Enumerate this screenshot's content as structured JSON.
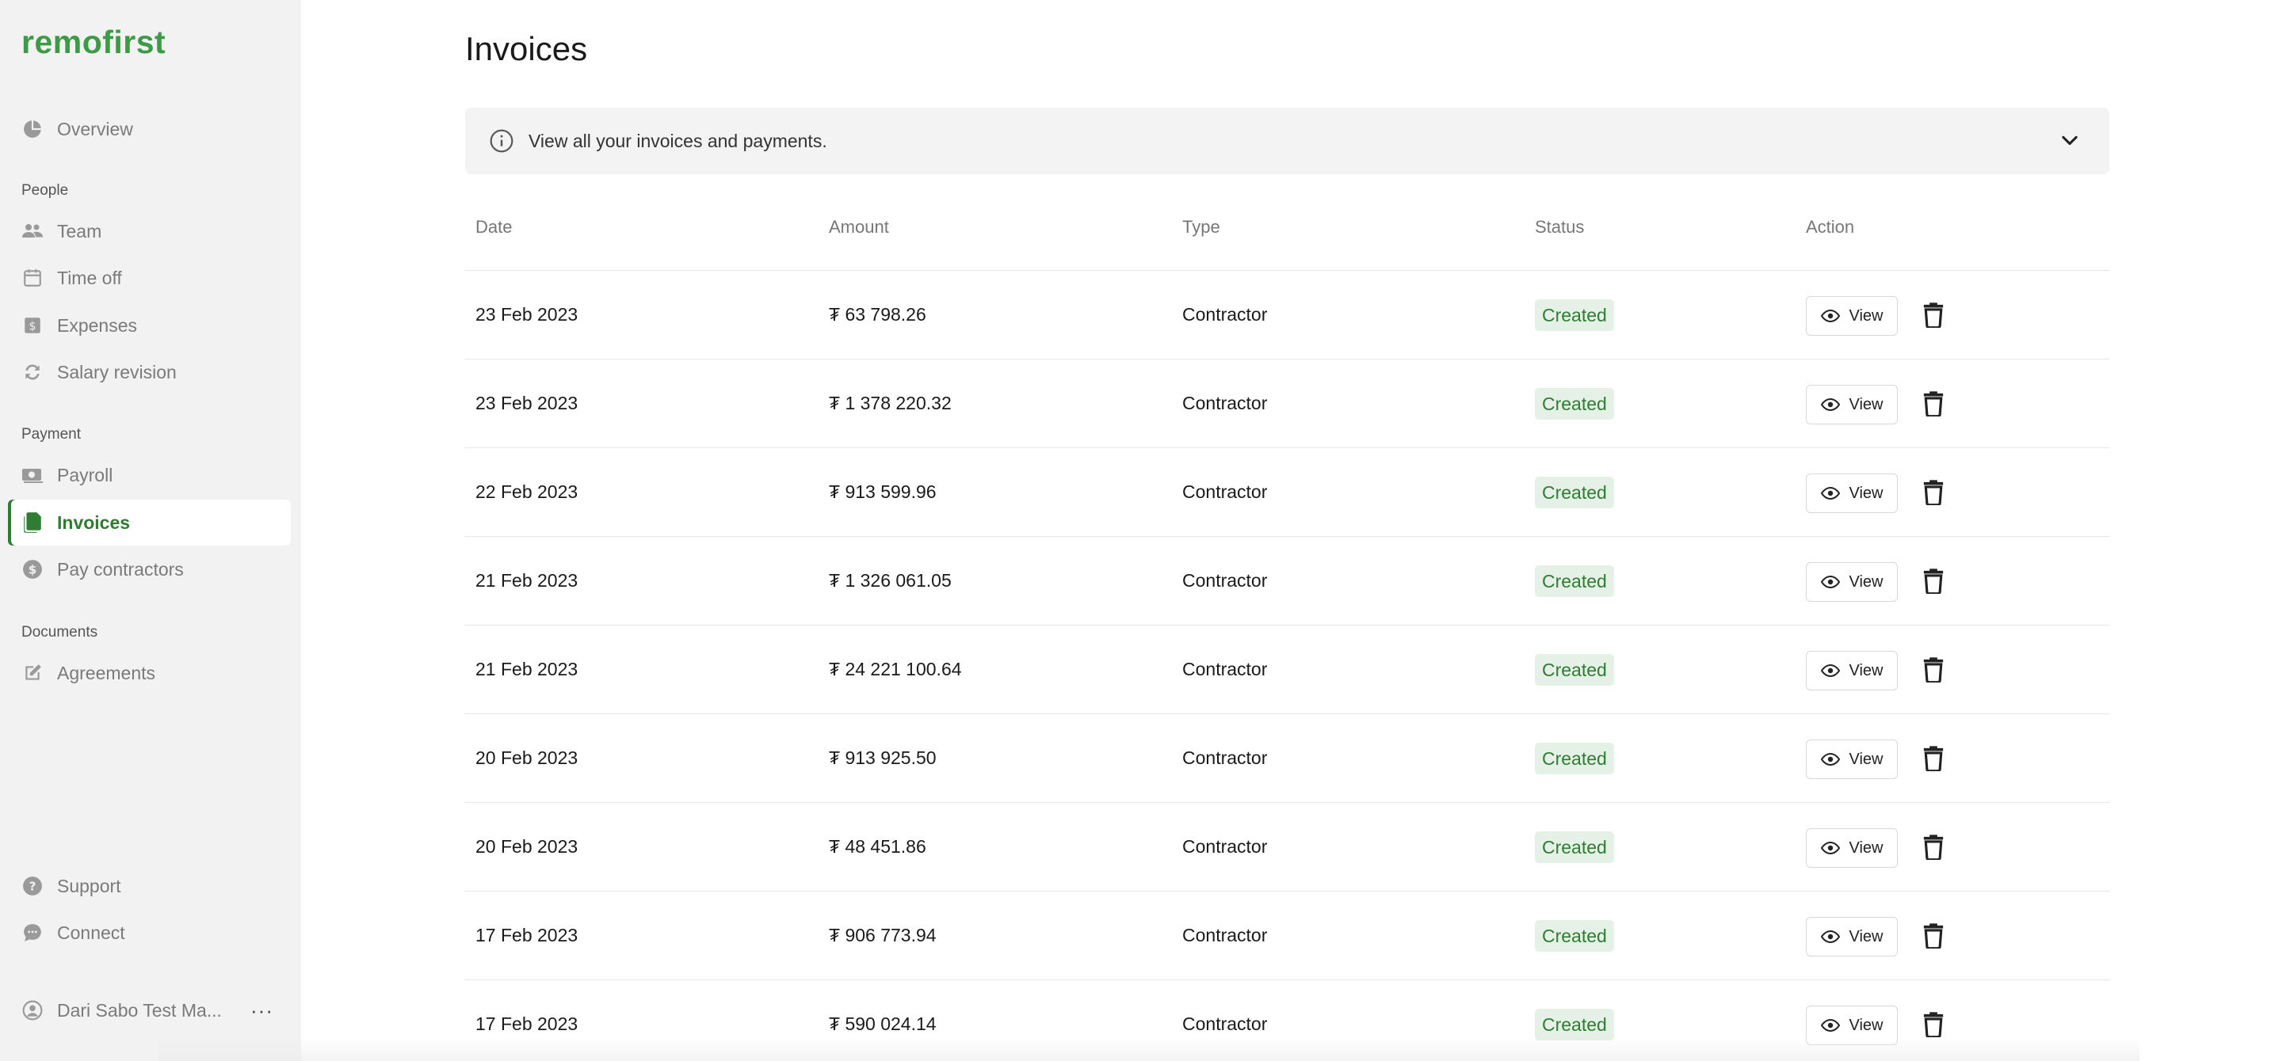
{
  "brand": {
    "logo": "remofirst",
    "accent": "#3d9b45",
    "active": "#2e7d32"
  },
  "sidebar": {
    "overview": {
      "label": "Overview",
      "icon": "pie-chart-icon"
    },
    "sections": {
      "people": "People",
      "payment": "Payment",
      "documents": "Documents"
    },
    "people_items": [
      {
        "label": "Team",
        "icon": "team-icon"
      },
      {
        "label": "Time off",
        "icon": "calendar-icon"
      },
      {
        "label": "Expenses",
        "icon": "receipt-icon"
      },
      {
        "label": "Salary revision",
        "icon": "refresh-icon"
      }
    ],
    "payment_items": [
      {
        "label": "Payroll",
        "icon": "payroll-icon"
      },
      {
        "label": "Invoices",
        "icon": "documents-icon",
        "active": true
      },
      {
        "label": "Pay contractors",
        "icon": "dollar-icon"
      }
    ],
    "document_items": [
      {
        "label": "Agreements",
        "icon": "edit-icon"
      }
    ],
    "footer_items": [
      {
        "label": "Support",
        "icon": "help-icon"
      },
      {
        "label": "Connect",
        "icon": "chat-icon"
      }
    ],
    "user": {
      "name": "Dari Sabo Test Ma...",
      "icon": "user-icon",
      "more": "···"
    }
  },
  "main": {
    "title": "Invoices",
    "banner": {
      "text": "View all your invoices and payments.",
      "icon": "info-icon",
      "toggle_icon": "chevron-down-icon"
    },
    "table": {
      "headers": {
        "date": "Date",
        "amount": "Amount",
        "type": "Type",
        "status": "Status",
        "action": "Action"
      },
      "view_label": "View",
      "rows": [
        {
          "date": "23 Feb 2023",
          "amount": "₮ 63 798.26",
          "type": "Contractor",
          "status": "Created"
        },
        {
          "date": "23 Feb 2023",
          "amount": "₮ 1 378 220.32",
          "type": "Contractor",
          "status": "Created"
        },
        {
          "date": "22 Feb 2023",
          "amount": "₮ 913 599.96",
          "type": "Contractor",
          "status": "Created"
        },
        {
          "date": "21 Feb 2023",
          "amount": "₮ 1 326 061.05",
          "type": "Contractor",
          "status": "Created"
        },
        {
          "date": "21 Feb 2023",
          "amount": "₮ 24 221 100.64",
          "type": "Contractor",
          "status": "Created"
        },
        {
          "date": "20 Feb 2023",
          "amount": "₮ 913 925.50",
          "type": "Contractor",
          "status": "Created"
        },
        {
          "date": "20 Feb 2023",
          "amount": "₮ 48 451.86",
          "type": "Contractor",
          "status": "Created"
        },
        {
          "date": "17 Feb 2023",
          "amount": "₮ 906 773.94",
          "type": "Contractor",
          "status": "Created"
        },
        {
          "date": "17 Feb 2023",
          "amount": "₮ 590 024.14",
          "type": "Contractor",
          "status": "Created"
        }
      ]
    }
  }
}
